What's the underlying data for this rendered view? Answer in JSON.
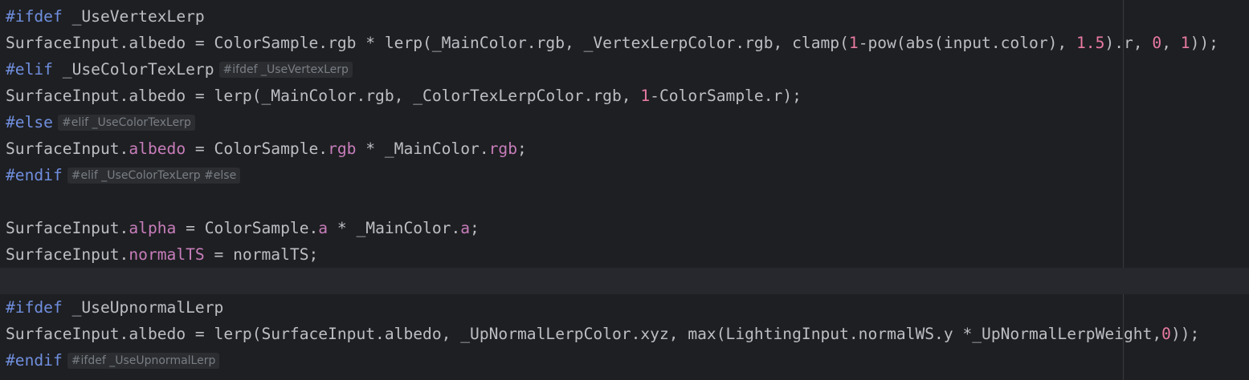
{
  "colors": {
    "background": "#1e1f22",
    "current_line": "#26282e",
    "directive": "#6f8ede",
    "text": "#bcbec4",
    "field": "#c77dbb",
    "number": "#e87aa1",
    "hint_text": "#7a7e85",
    "hint_background": "#2b2d30"
  },
  "editor": {
    "lines": [
      {
        "tokens": [
          {
            "text": "#ifdef",
            "kind": "directive"
          },
          {
            "text": " _UseVertexLerp",
            "kind": "plain"
          }
        ],
        "hint": ""
      },
      {
        "tokens": [
          {
            "text": "SurfaceInput.albedo = ColorSample.rgb * lerp(_MainColor.rgb, _VertexLerpColor.rgb, clamp(",
            "kind": "plain"
          },
          {
            "text": "1",
            "kind": "num"
          },
          {
            "text": "-pow(abs(input.color), ",
            "kind": "plain"
          },
          {
            "text": "1.5",
            "kind": "num"
          },
          {
            "text": ").r, ",
            "kind": "plain"
          },
          {
            "text": "0",
            "kind": "num"
          },
          {
            "text": ", ",
            "kind": "plain"
          },
          {
            "text": "1",
            "kind": "num"
          },
          {
            "text": "));",
            "kind": "plain"
          }
        ],
        "hint": ""
      },
      {
        "tokens": [
          {
            "text": "#elif",
            "kind": "directive"
          },
          {
            "text": " _UseColorTexLerp",
            "kind": "plain"
          }
        ],
        "hint": "#ifdef _UseVertexLerp"
      },
      {
        "tokens": [
          {
            "text": "SurfaceInput.albedo = lerp(_MainColor.rgb, _ColorTexLerpColor.rgb, ",
            "kind": "plain"
          },
          {
            "text": "1",
            "kind": "num"
          },
          {
            "text": "-ColorSample.r);",
            "kind": "plain"
          }
        ],
        "hint": ""
      },
      {
        "tokens": [
          {
            "text": "#else",
            "kind": "directive"
          }
        ],
        "hint": "#elif _UseColorTexLerp"
      },
      {
        "tokens": [
          {
            "text": "SurfaceInput.",
            "kind": "plain"
          },
          {
            "text": "albedo",
            "kind": "field"
          },
          {
            "text": " = ColorSample.",
            "kind": "plain"
          },
          {
            "text": "rgb",
            "kind": "field"
          },
          {
            "text": " * _MainColor.",
            "kind": "plain"
          },
          {
            "text": "rgb",
            "kind": "field"
          },
          {
            "text": ";",
            "kind": "plain"
          }
        ],
        "hint": ""
      },
      {
        "tokens": [
          {
            "text": "#endif",
            "kind": "directive"
          }
        ],
        "hint": "#elif _UseColorTexLerp #else"
      },
      {
        "tokens": [],
        "hint": ""
      },
      {
        "tokens": [
          {
            "text": "SurfaceInput.",
            "kind": "plain"
          },
          {
            "text": "alpha",
            "kind": "field"
          },
          {
            "text": " = ColorSample.",
            "kind": "plain"
          },
          {
            "text": "a",
            "kind": "field"
          },
          {
            "text": " * _MainColor.",
            "kind": "plain"
          },
          {
            "text": "a",
            "kind": "field"
          },
          {
            "text": ";",
            "kind": "plain"
          }
        ],
        "hint": ""
      },
      {
        "tokens": [
          {
            "text": "SurfaceInput.",
            "kind": "plain"
          },
          {
            "text": "normalTS",
            "kind": "field"
          },
          {
            "text": " = normalTS;",
            "kind": "plain"
          }
        ],
        "hint": ""
      },
      {
        "tokens": [],
        "hint": ""
      },
      {
        "tokens": [
          {
            "text": "#ifdef",
            "kind": "directive"
          },
          {
            "text": " _UseUpnormalLerp",
            "kind": "plain"
          }
        ],
        "hint": ""
      },
      {
        "tokens": [
          {
            "text": "SurfaceInput.albedo = lerp(SurfaceInput.albedo, _UpNormalLerpColor.xyz, max(LightingInput.normalWS.y *_UpNormalLerpWeight,",
            "kind": "plain"
          },
          {
            "text": "0",
            "kind": "num"
          },
          {
            "text": "));",
            "kind": "plain"
          }
        ],
        "hint": ""
      },
      {
        "tokens": [
          {
            "text": "#endif",
            "kind": "directive"
          }
        ],
        "hint": "#ifdef _UseUpnormalLerp"
      }
    ],
    "current_line_index": 10
  }
}
